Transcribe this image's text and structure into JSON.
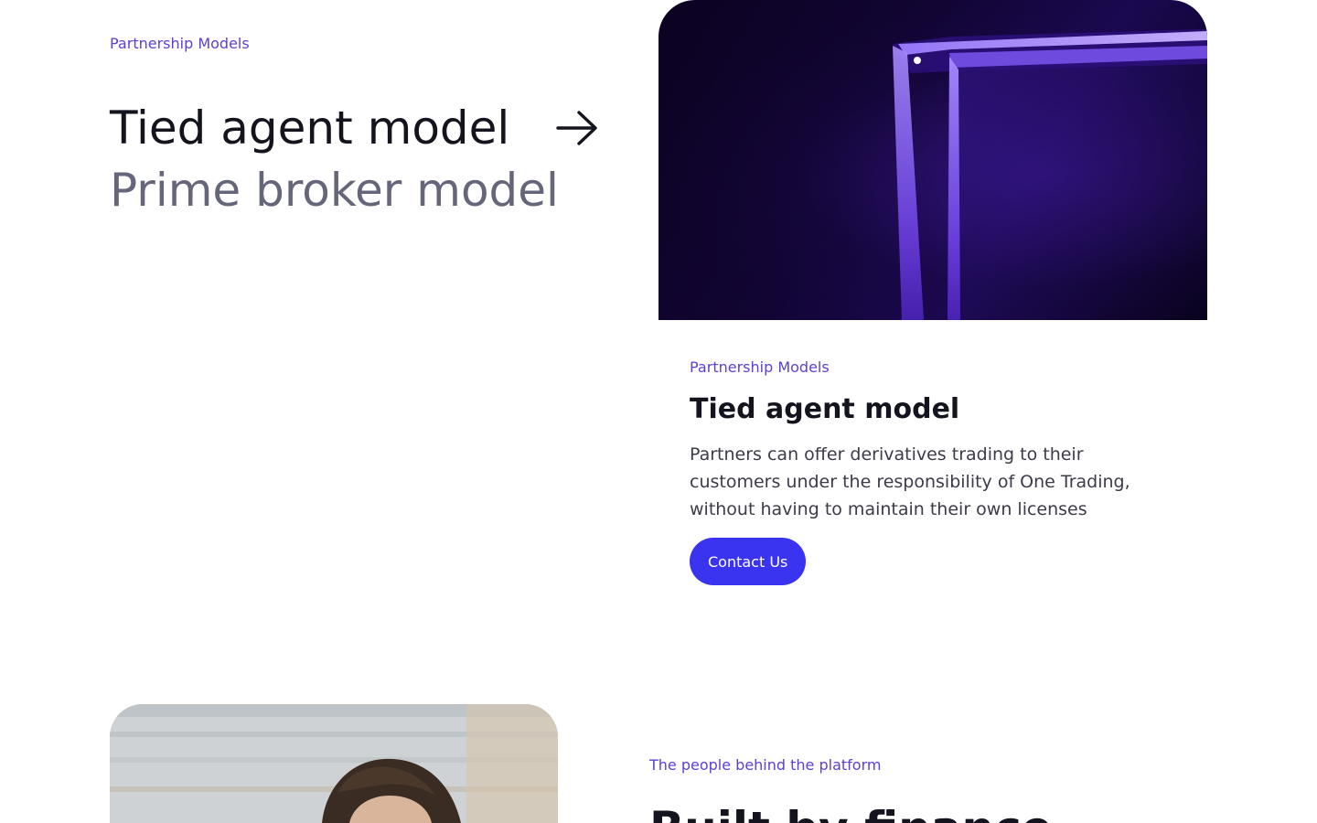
{
  "partnership": {
    "eyebrow": "Partnership Models",
    "models": [
      {
        "label": "Tied agent model",
        "active": true
      },
      {
        "label": "Prime broker model",
        "active": false
      }
    ]
  },
  "card": {
    "eyebrow": "Partnership Models",
    "title": "Tied agent model",
    "description": "Partners can offer derivatives trading to their customers under the responsibility of One Trading, without having to maintain their own licenses",
    "cta_label": "Contact Us"
  },
  "people": {
    "eyebrow": "The people behind the platform",
    "title": "Built by finance"
  },
  "colors": {
    "accent": "#5b3fd6",
    "button": "#3a34f0",
    "text_primary": "#14141f",
    "text_muted": "#66667a"
  }
}
